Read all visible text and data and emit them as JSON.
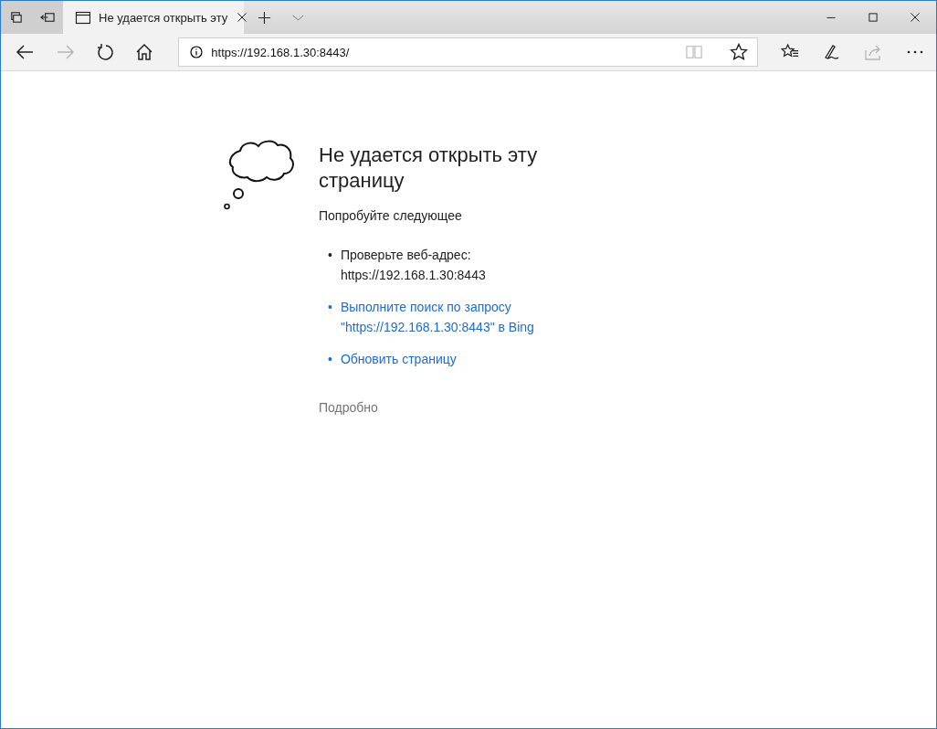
{
  "tab_bar": {
    "left_buttons": [
      {
        "kind": "tabs-aside"
      },
      {
        "kind": "restore-tabs"
      }
    ],
    "tabs": [
      {
        "title": "Не удается открыть эту",
        "selected": true
      }
    ],
    "window_controls": [
      {
        "kind": "minimize"
      },
      {
        "kind": "maximize"
      },
      {
        "kind": "close"
      }
    ]
  },
  "toolbar": {
    "nav_buttons": [
      {
        "kind": "back",
        "disabled": false
      },
      {
        "kind": "forward",
        "disabled": true
      },
      {
        "kind": "refresh",
        "disabled": false
      },
      {
        "kind": "home",
        "disabled": false
      }
    ],
    "address": {
      "value": "https://192.168.1.30:8443/"
    },
    "address_buttons": [
      {
        "kind": "reading",
        "disabled": true
      },
      {
        "kind": "favorite",
        "disabled": false
      }
    ],
    "tool_buttons": [
      {
        "kind": "favorites",
        "disabled": false
      },
      {
        "kind": "notes",
        "disabled": false
      },
      {
        "kind": "share",
        "disabled": true
      },
      {
        "kind": "more",
        "disabled": false
      }
    ]
  },
  "error_page": {
    "title": "Не удается открыть эту страницу",
    "subtitle": "Попробуйте следующее",
    "suggestions": [
      {
        "kind": "text",
        "marker": "•",
        "lines": [
          "Проверьте веб-адрес:",
          "https://192.168.1.30:8443"
        ]
      },
      {
        "kind": "link",
        "marker": "•",
        "lines": [
          "Выполните поиск по запросу",
          "\"https://192.168.1.30:8443\" в Bing"
        ]
      },
      {
        "kind": "link",
        "marker": "•",
        "lines": [
          "Обновить страницу"
        ]
      }
    ],
    "details": "Подробно"
  }
}
